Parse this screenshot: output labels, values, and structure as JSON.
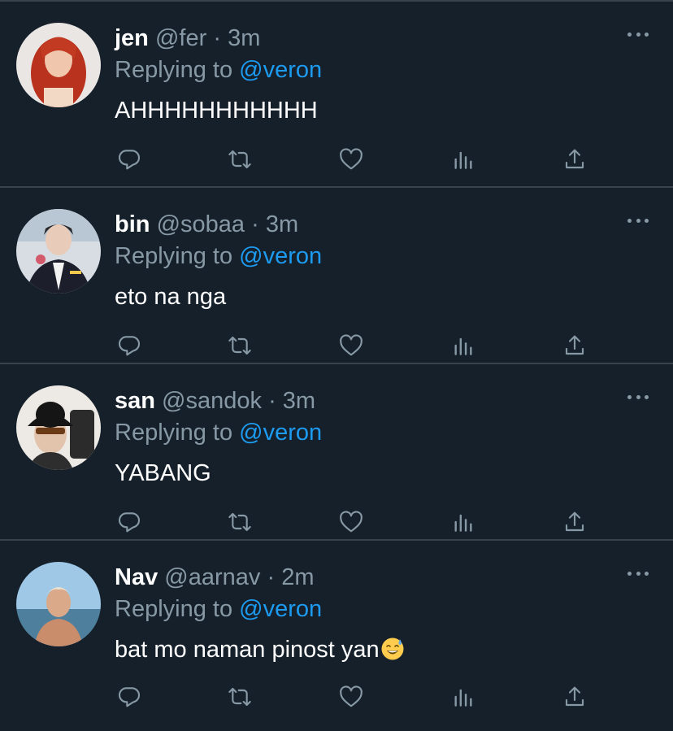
{
  "tweets": [
    {
      "name": "jen",
      "handle": "@fer",
      "separator": "·",
      "time": "3m",
      "replying_prefix": "Replying to",
      "replying_to": "@veron",
      "text": "AHHHHHHHHHHH",
      "avatar_icon": "red-hair-avatar"
    },
    {
      "name": "bin",
      "handle": "@sobaa",
      "separator": "·",
      "time": "3m",
      "replying_prefix": "Replying to",
      "replying_to": "@veron",
      "text": "eto na nga",
      "avatar_icon": "suit-avatar"
    },
    {
      "name": "san",
      "handle": "@sandok",
      "separator": "·",
      "time": "3m",
      "replying_prefix": "Replying to",
      "replying_to": "@veron",
      "text": "YABANG",
      "avatar_icon": "bucket-hat-avatar"
    },
    {
      "name": "Nav",
      "handle": "@aarnav",
      "separator": "·",
      "time": "2m",
      "replying_prefix": "Replying to",
      "replying_to": "@veron",
      "text": "bat mo naman pinost yan",
      "text_emoji": "sweat-smile-emoji",
      "avatar_icon": "beach-avatar"
    }
  ],
  "action_icons": [
    "reply-icon",
    "retweet-icon",
    "like-icon",
    "stats-icon",
    "share-icon"
  ],
  "colors": {
    "background": "#15202b",
    "divider": "#38444d",
    "secondary_text": "#8899a6",
    "mention": "#1d9bf0",
    "primary_text": "#ffffff"
  }
}
